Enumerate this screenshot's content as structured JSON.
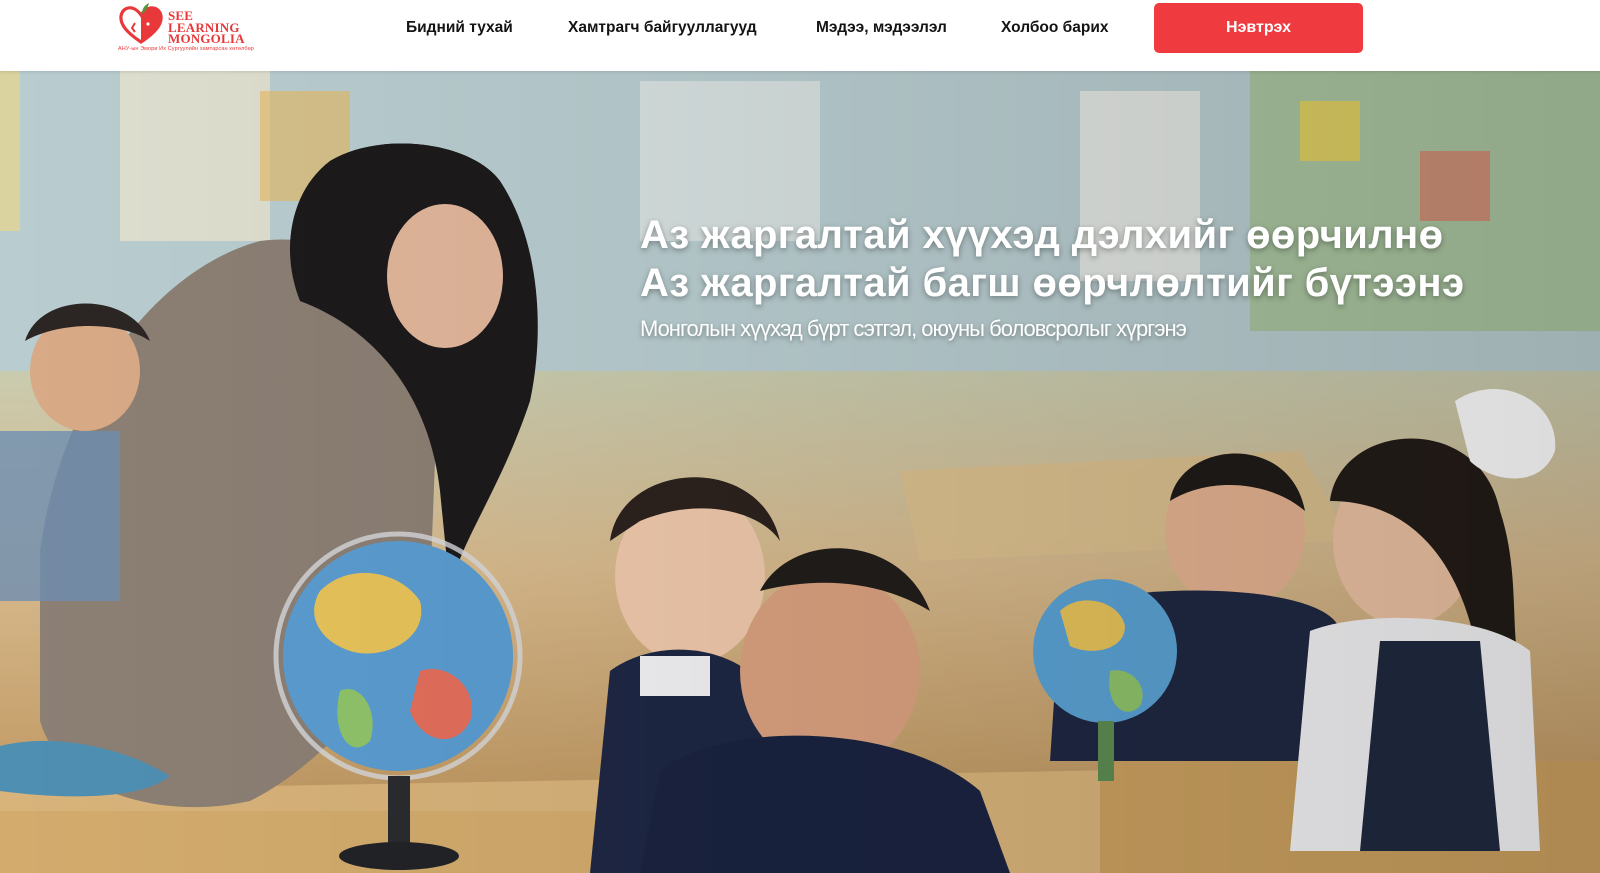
{
  "header": {
    "logo": {
      "lines": [
        "SEE",
        "LEARNING",
        "MONGOLIA"
      ],
      "tagline": "АНУ-ын Эмори Их Сургуулийн хамтарсан хөтөлбөр",
      "icon": "heart-apple-logo",
      "color": "#e8383a"
    },
    "nav": {
      "about": "Бидний тухай",
      "partners": "Хамтрагч байгууллагууд",
      "news": "Мэдээ, мэдээлэл",
      "contact": "Холбоо барих"
    },
    "login_label": "Нэвтрэх",
    "login_color": "#ef3b3f"
  },
  "hero": {
    "title_line_1": "Аз жаргалтай хүүхэд дэлхийг өөрчилнө",
    "title_line_2": "Аз жаргалтай багш өөрчлөлтийг бүтээнэ",
    "subtitle": "Монголын хүүхэд бүрт сэтгэл, оюуны боловсролыг хүргэнэ",
    "photo": "classroom-teacher-children-globes-photo"
  }
}
